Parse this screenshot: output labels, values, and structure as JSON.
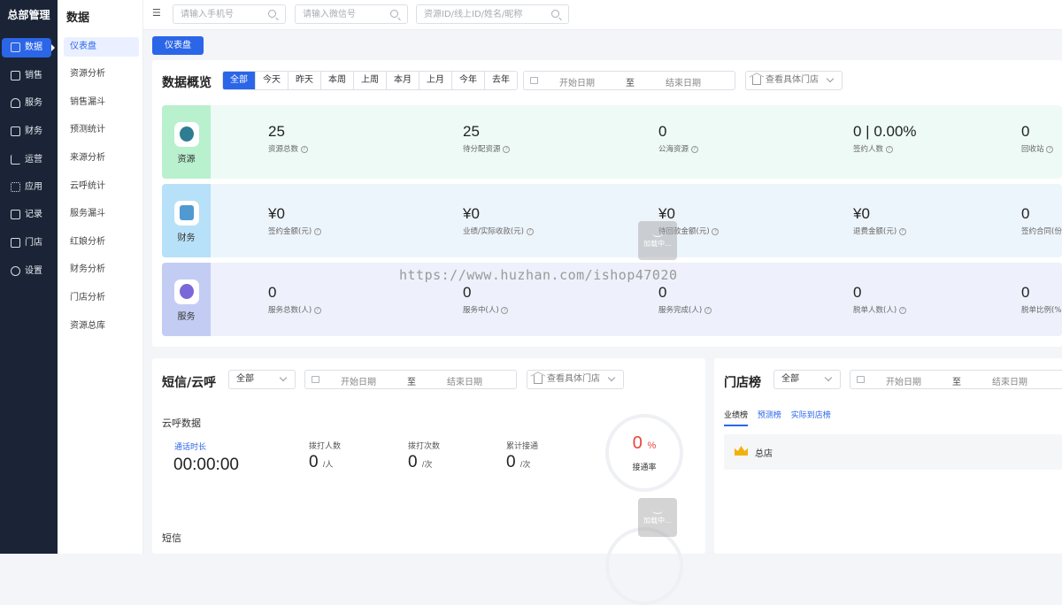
{
  "app": {
    "brand": "总部管理"
  },
  "nav": [
    {
      "label": "数据",
      "icon": "dashboard-icon"
    },
    {
      "label": "销售",
      "icon": "sales-icon"
    },
    {
      "label": "服务",
      "icon": "service-icon"
    },
    {
      "label": "财务",
      "icon": "finance-icon"
    },
    {
      "label": "运营",
      "icon": "operation-icon"
    },
    {
      "label": "应用",
      "icon": "apps-icon"
    },
    {
      "label": "记录",
      "icon": "records-icon"
    },
    {
      "label": "门店",
      "icon": "store-icon"
    },
    {
      "label": "设置",
      "icon": "settings-icon"
    }
  ],
  "submenu": {
    "title": "数据",
    "items": [
      "仪表盘",
      "资源分析",
      "销售漏斗",
      "预测统计",
      "来源分析",
      "云呼统计",
      "服务漏斗",
      "红娘分析",
      "财务分析",
      "门店分析",
      "资源总库"
    ]
  },
  "topbar": {
    "phone_placeholder": "请输入手机号",
    "wechat_placeholder": "请输入微信号",
    "resource_placeholder": "资源ID/线上ID/姓名/昵称"
  },
  "page_tab": "仪表盘",
  "overview": {
    "title": "数据概览",
    "filters": [
      "全部",
      "今天",
      "昨天",
      "本周",
      "上周",
      "本月",
      "上月",
      "今年",
      "去年"
    ],
    "start_date": "开始日期",
    "to": "至",
    "end_date": "结束日期",
    "store_placeholder": "查看具体门店",
    "rows": [
      {
        "label": "资源",
        "metrics": [
          {
            "value": "25",
            "key": "资源总数"
          },
          {
            "value": "25",
            "key": "待分配资源"
          },
          {
            "value": "0",
            "key": "公海资源"
          },
          {
            "value": "0 | 0.00%",
            "key": "签约人数"
          },
          {
            "value": "0",
            "key": "回收站"
          }
        ]
      },
      {
        "label": "财务",
        "metrics": [
          {
            "value": "¥0",
            "key": "签约金额(元)"
          },
          {
            "value": "¥0",
            "key": "业绩/实际收款(元)"
          },
          {
            "value": "¥0",
            "key": "待回款金额(元)"
          },
          {
            "value": "¥0",
            "key": "退费金额(元)"
          },
          {
            "value": "0",
            "key": "签约合同(份)"
          }
        ]
      },
      {
        "label": "服务",
        "metrics": [
          {
            "value": "0",
            "key": "服务总数(人)"
          },
          {
            "value": "0",
            "key": "服务中(人)"
          },
          {
            "value": "0",
            "key": "服务完成(人)"
          },
          {
            "value": "0",
            "key": "脱单人数(人)"
          },
          {
            "value": "0",
            "key": "脱单比例(%)"
          }
        ]
      }
    ]
  },
  "loading_text": "加载中...",
  "watermark": "https://www.huzhan.com/ishop47020",
  "sms": {
    "title": "短信/云呼",
    "scope": "全部",
    "start_date": "开始日期",
    "to": "至",
    "end_date": "结束日期",
    "store_placeholder": "查看具体门店",
    "call_section": "云呼数据",
    "call_duration_label": "通话时长",
    "call_duration": "00:00:00",
    "callers_label": "拨打人数",
    "callers": "0",
    "callers_unit": "/人",
    "calls_label": "拨打次数",
    "calls": "0",
    "calls_unit": "/次",
    "connected_label": "累计接通",
    "connected": "0",
    "connected_unit": "/次",
    "rate": "0",
    "rate_unit": "%",
    "rate_label": "接通率",
    "sms_section": "短信"
  },
  "ranking": {
    "title": "门店榜",
    "scope": "全部",
    "start_date": "开始日期",
    "to": "至",
    "end_date": "结束日期",
    "tabs": [
      "业绩榜",
      "预测榜",
      "实际到店榜"
    ],
    "stores": [
      {
        "name": "总店"
      }
    ]
  },
  "colors": {
    "accent": "#2b66e8",
    "sidebar": "#1b2436",
    "rate": "#e8463a"
  }
}
